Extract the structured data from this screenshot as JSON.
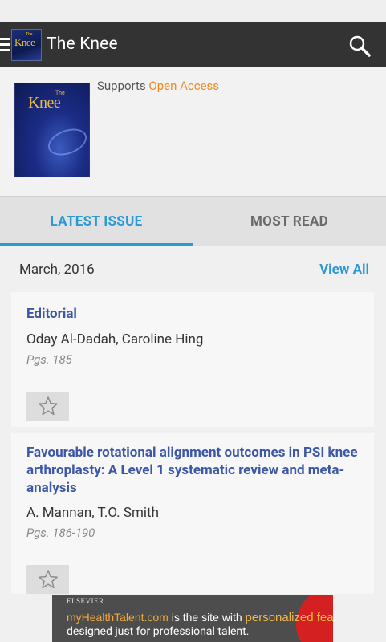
{
  "app": {
    "title": "The Knee",
    "logo_text": "Knee",
    "logo_the": "The"
  },
  "journal": {
    "cover_title": "Knee",
    "cover_the": "The",
    "supports_prefix": "Supports ",
    "supports_link": "Open Access"
  },
  "tabs": [
    {
      "label": "LATEST ISSUE",
      "selected": true
    },
    {
      "label": "MOST READ",
      "selected": false
    }
  ],
  "issue": {
    "date": "March, 2016",
    "view_all": "View All"
  },
  "articles": [
    {
      "title": "Editorial",
      "authors": "Oday Al-Dadah, Caroline Hing",
      "pages": "Pgs. 185"
    },
    {
      "title": "Favourable rotational alignment outcomes in PSI knee arthroplasty: A Level 1 systematic review and meta-analysis",
      "authors": "A. Mannan, T.O. Smith",
      "pages": "Pgs. 186-190"
    }
  ],
  "ad": {
    "brand": "ELSEVIER",
    "site": "myHealthTalent.com",
    "mid": " is the site with ",
    "highlight": "personalized features",
    "line2": "designed just for professional talent."
  },
  "colors": {
    "accent": "#2b9ad4",
    "appbar": "#333333",
    "article_title": "#3c57a6",
    "open_access": "#f08a1c"
  }
}
